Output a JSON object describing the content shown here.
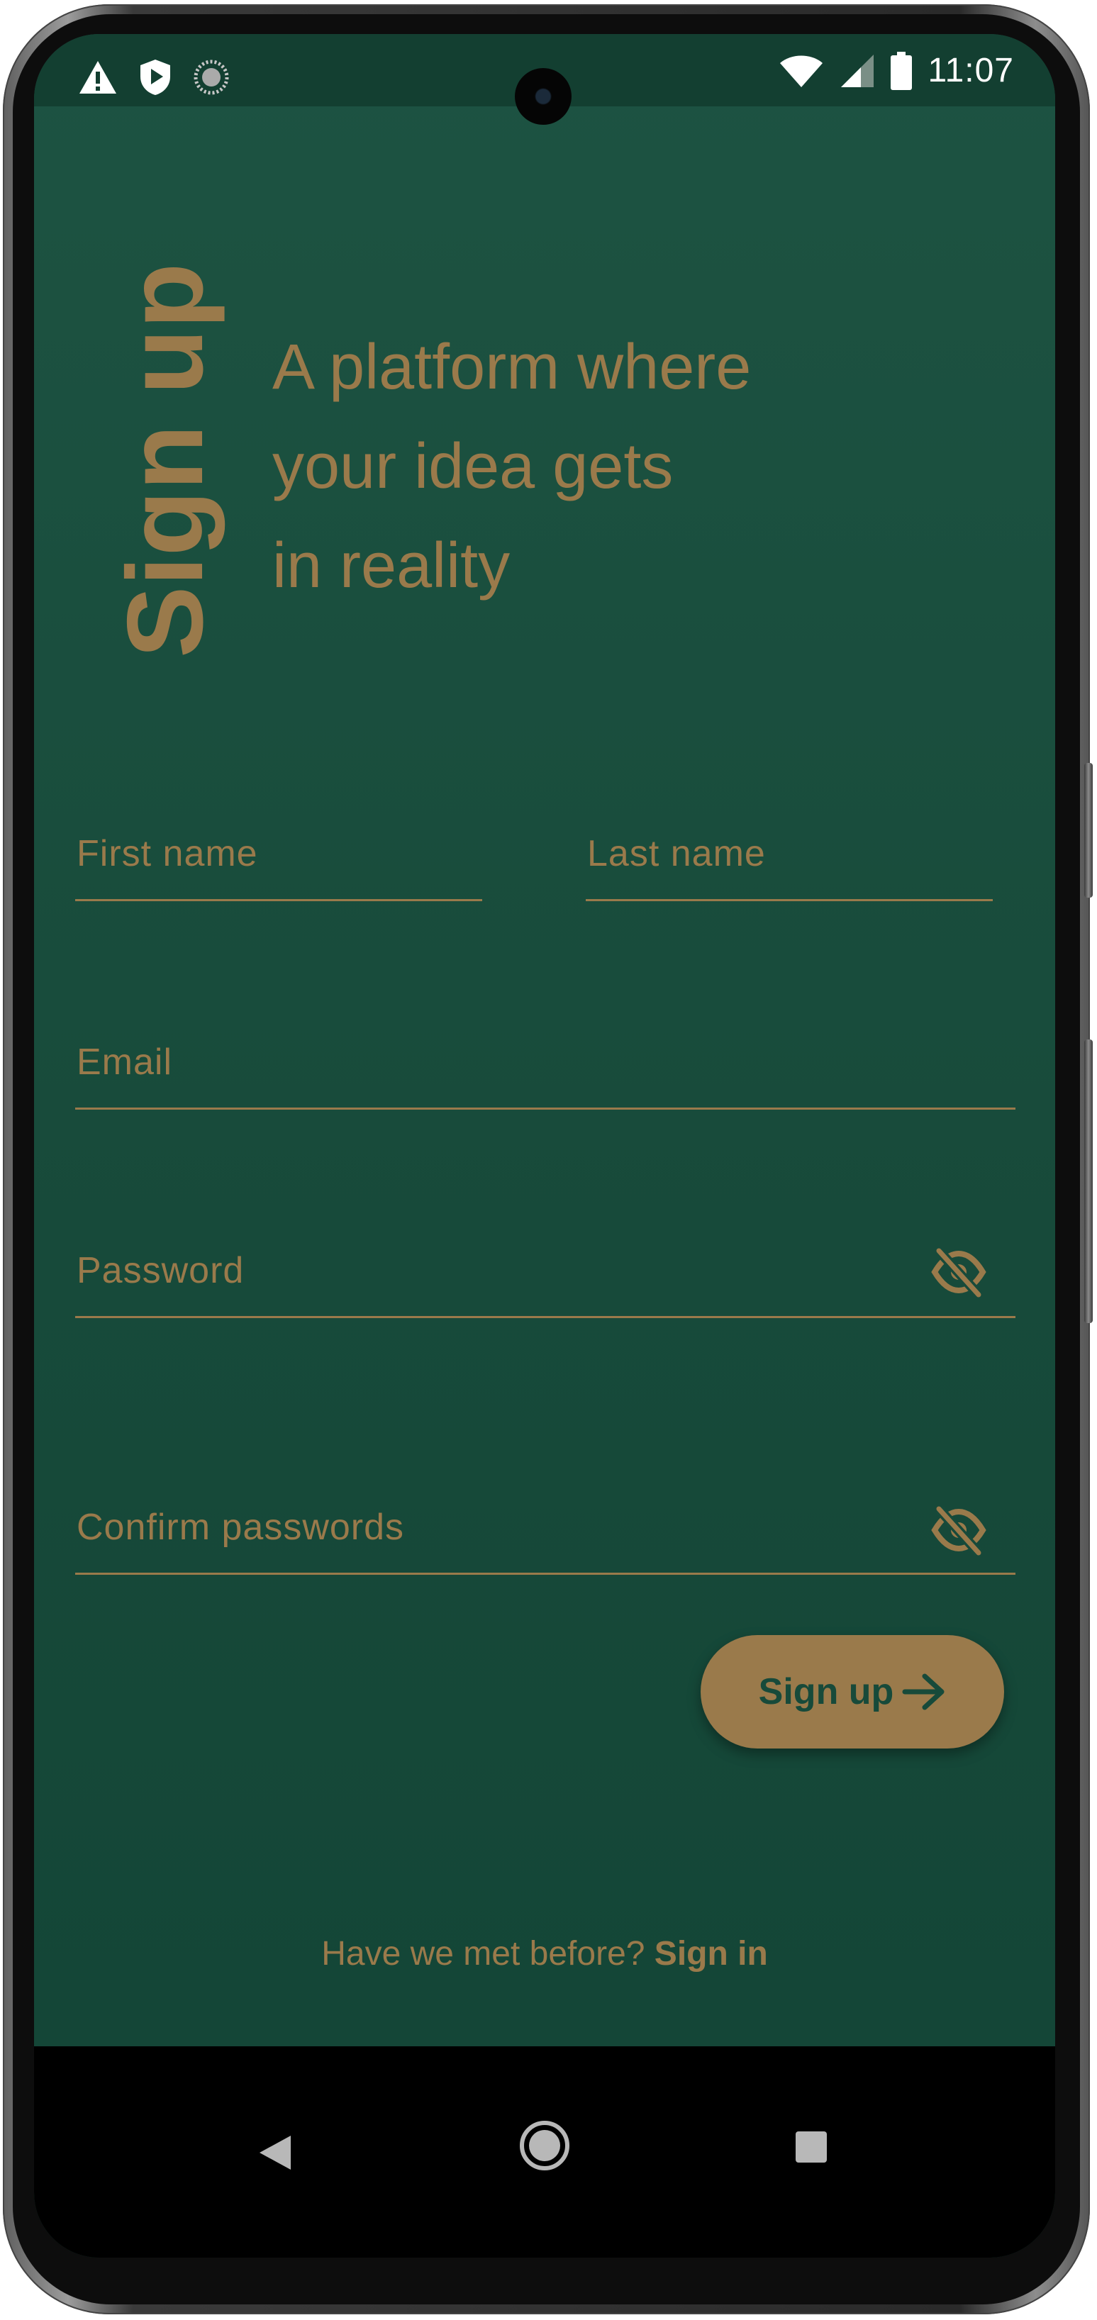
{
  "status_bar": {
    "left_icons": [
      "warning-icon",
      "shield-play-icon",
      "progress-circle-icon"
    ],
    "right_icons": [
      "wifi-icon",
      "signal-icon",
      "battery-icon"
    ],
    "time": "11:07"
  },
  "header": {
    "title": "Sign up",
    "tagline_lines": [
      "A platform where",
      "your idea gets",
      "in reality"
    ]
  },
  "form": {
    "first_name_label": "First name",
    "last_name_label": "Last name",
    "email_label": "Email",
    "password_label": "Password",
    "confirm_password_label": "Confirm passwords",
    "password_visibility_icon": "eye-off-icon",
    "submit_label": "Sign up",
    "submit_icon": "arrow-right-icon"
  },
  "footer": {
    "prompt": "Have we met before?",
    "link": "Sign in"
  },
  "nav_bar": {
    "buttons": [
      "back-icon",
      "home-icon",
      "recents-icon"
    ]
  },
  "colors": {
    "background": "#1d5342",
    "accent": "#9a7a4b",
    "status_bar": "#133f31"
  }
}
